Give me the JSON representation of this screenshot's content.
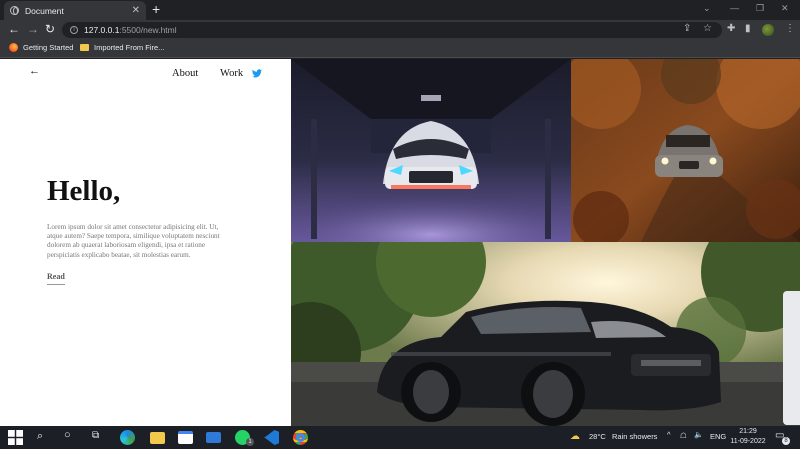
{
  "browser": {
    "tab_title": "Document",
    "url_host": "127.0.0.1",
    "url_rest": ":5500/new.html",
    "bookmarks": [
      "Getting Started",
      "Imported From Fire..."
    ]
  },
  "page": {
    "nav": {
      "about": "About",
      "work": "Work"
    },
    "heading": "Hello,",
    "body": "Lorem ipsum dolor sit amet consectetur adipisicing elit. Ut, atque autem? Saepe tempora, similique voluptatem nesciunt dolorem ab quaerat laboriosam eligendi, ipsa et ratione perspiciatis explicabo beatae, sit molestias earum.",
    "read_link": "Read",
    "images": [
      "car-in-garage-photo",
      "car-on-autumn-road-photo",
      "black-mustang-sunset-photo"
    ]
  },
  "taskbar": {
    "weather_temp": "28°C",
    "weather_text": "Rain showers",
    "language": "ENG",
    "time": "21:29",
    "date": "11-09-2022",
    "notification_count": "8",
    "whatsapp_badge": "1"
  },
  "colors": {
    "twitter": "#1d9bf0",
    "chrome_dark": "#202124",
    "chrome_toolbar": "#35363a",
    "taskbar": "#1c2026"
  }
}
